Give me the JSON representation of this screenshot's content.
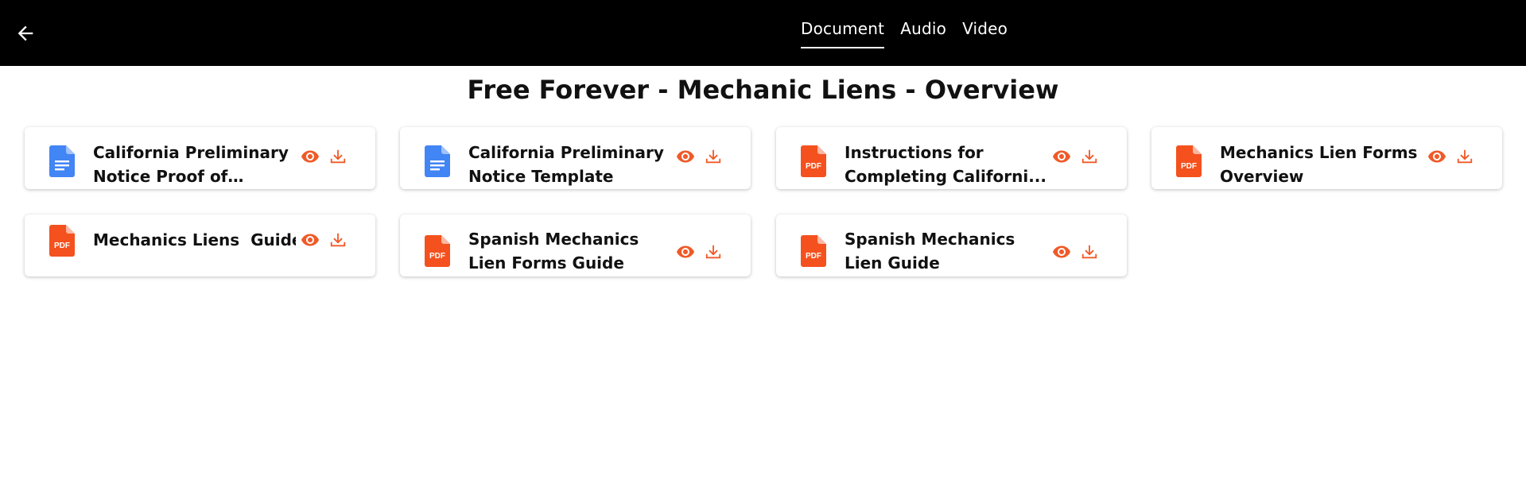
{
  "nav": {
    "tabs": [
      {
        "label": "Document",
        "active": true
      },
      {
        "label": "Audio",
        "active": false
      },
      {
        "label": "Video",
        "active": false
      }
    ]
  },
  "page": {
    "title": "Free Forever - Mechanic Liens - Overview"
  },
  "colors": {
    "accent": "#f05a28",
    "doc_blue": "#4285f4",
    "header_bg": "#000000"
  },
  "documents": [
    {
      "name": "California Preliminary Notice Proof of Service",
      "type": "doc",
      "icon": "google-doc-icon"
    },
    {
      "name": "California Preliminary Notice Template",
      "type": "doc",
      "icon": "google-doc-icon"
    },
    {
      "name": "Instructions for Completing Californi...",
      "type": "pdf",
      "icon": "pdf-icon",
      "icon_label": "PDF"
    },
    {
      "name": "Mechanics Lien Forms Overview",
      "type": "pdf",
      "icon": "pdf-icon",
      "icon_label": "PDF"
    },
    {
      "name": "Mechanics Liens  Guide",
      "type": "pdf",
      "icon": "pdf-icon",
      "icon_label": "PDF"
    },
    {
      "name": "Spanish Mechanics Lien Forms Guide",
      "type": "pdf",
      "icon": "pdf-icon",
      "icon_label": "PDF"
    },
    {
      "name": "Spanish Mechanics Lien Guide",
      "type": "pdf",
      "icon": "pdf-icon",
      "icon_label": "PDF"
    }
  ]
}
